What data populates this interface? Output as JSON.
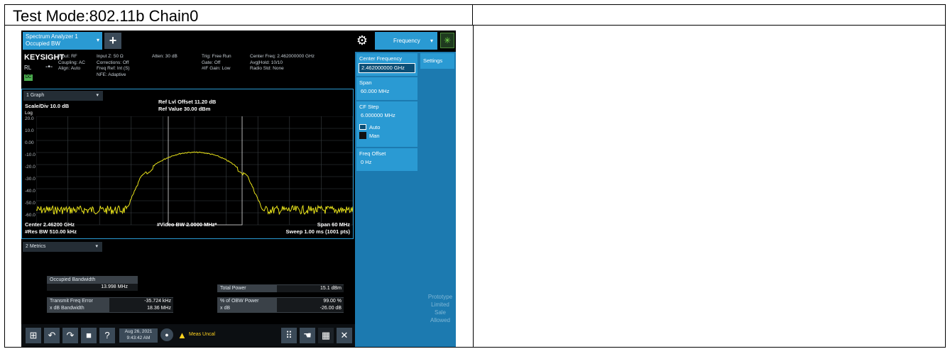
{
  "document": {
    "title": "Test Mode:802.11b Chain0"
  },
  "instrument": {
    "tab": {
      "line1": "Spectrum Analyzer 1",
      "line2": "Occupied BW"
    },
    "plus_symbol": "+",
    "freq_tab_label": "Frequency",
    "brand": "KEYSIGHT",
    "rl": "RL",
    "dc": "DC",
    "info_columns": [
      {
        "lines": [
          "Input: RF",
          "Coupling: AC",
          "Align: Auto"
        ]
      },
      {
        "lines": [
          "Input Z: 50 Ω",
          "Corrections: Off",
          "Freq Ref: Int (S)",
          "NFE: Adaptive"
        ]
      },
      {
        "lines": [
          "Atten: 30 dB"
        ]
      },
      {
        "lines": [
          "Trig: Free Run",
          "Gate: Off",
          "#IF Gain: Low"
        ]
      },
      {
        "lines": [
          "Center Freq: 2.462000000 GHz",
          "Avg|Hold: 10/10",
          "Radio Std: None"
        ]
      }
    ],
    "graph": {
      "window_label": "1 Graph",
      "scale": "Scale/Div 10.0 dB",
      "log": "Log",
      "ref_offset": "Ref Lvl Offset 11.20 dB",
      "ref_value": "Ref Value 30.00 dBm",
      "yticks": [
        "20.0",
        "10.0",
        "0.00",
        "-10.0",
        "-20.0",
        "-30.0",
        "-40.0",
        "-50.0",
        "-60.0"
      ],
      "center": "Center 2.46200 GHz",
      "res_bw": "#Res BW 510.00 kHz",
      "video_bw": "#Video BW 2.0000 MHz*",
      "span": "Span 60 MHz",
      "sweep": "Sweep 1.00 ms (1001 pts)",
      "trace_color": "#e8e21a"
    },
    "metrics": {
      "window_label": "2 Metrics",
      "obw_label": "Occupied Bandwidth",
      "obw_value": "13.998 MHz",
      "tfe_label": "Transmit Freq Error",
      "tfe_value": "-35.724 kHz",
      "xdb_bw_label": "x dB Bandwidth",
      "xdb_bw_value": "18.36 MHz",
      "total_power_label": "Total Power",
      "total_power_value": "15.1 dBm",
      "pct_obw_label": "% of OBW Power",
      "pct_obw_value": "99.00 %",
      "xdb_label": "x dB",
      "xdb_value": "-26.00 dB"
    },
    "softkeys": {
      "center_freq_label": "Center Frequency",
      "center_freq_value": "2.462000000 GHz",
      "span_label": "Span",
      "span_value": "60.000 MHz",
      "cf_step_label": "CF Step",
      "cf_step_value": "6.000000 MHz",
      "auto": "Auto",
      "man": "Man",
      "freq_offset_label": "Freq Offset",
      "freq_offset_value": "0 Hz",
      "settings_tab": "Settings",
      "prototype_lines": [
        "Prototype",
        "Limited",
        "Sale",
        "Allowed"
      ]
    },
    "taskbar": {
      "date": "Aug 26, 2021",
      "time": "9:43:42 AM",
      "meas_status": "Meas Uncal"
    }
  }
}
